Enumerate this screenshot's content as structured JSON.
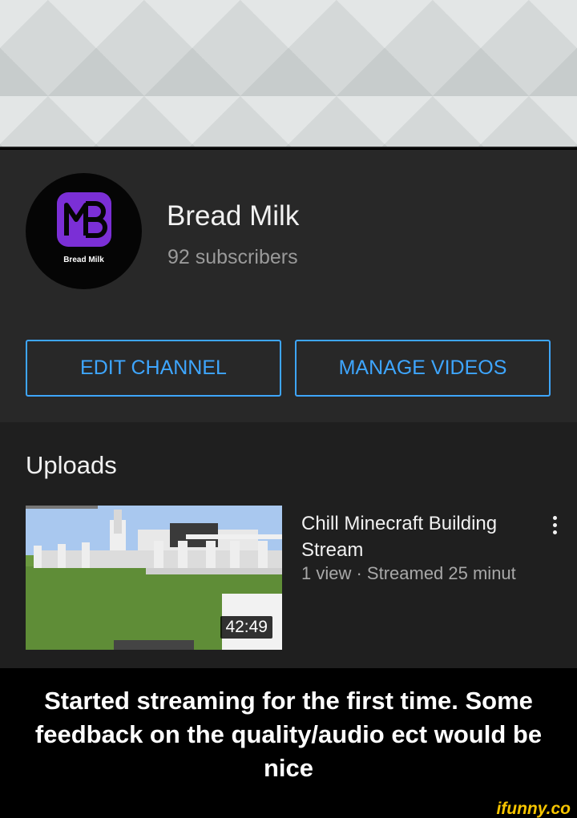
{
  "channel": {
    "name": "Bread Milk",
    "subscribers": "92 subscribers",
    "avatar_text": "Bread Milk",
    "avatar_logo": "MB",
    "accent_color": "#7b2fd6"
  },
  "actions": {
    "edit_label": "EDIT CHANNEL",
    "manage_label": "MANAGE VIDEOS",
    "color": "#3ea6ff"
  },
  "uploads": {
    "title": "Uploads",
    "videos": [
      {
        "title": "Chill Minecraft Building Stream",
        "meta": "1 view · Streamed 25 minut",
        "duration": "42:49",
        "more_icon": "more-vertical-icon"
      }
    ]
  },
  "caption": "Started streaming for the first time. Some feedback on the quality/audio ect would be nice",
  "watermark": "ifunny.co"
}
